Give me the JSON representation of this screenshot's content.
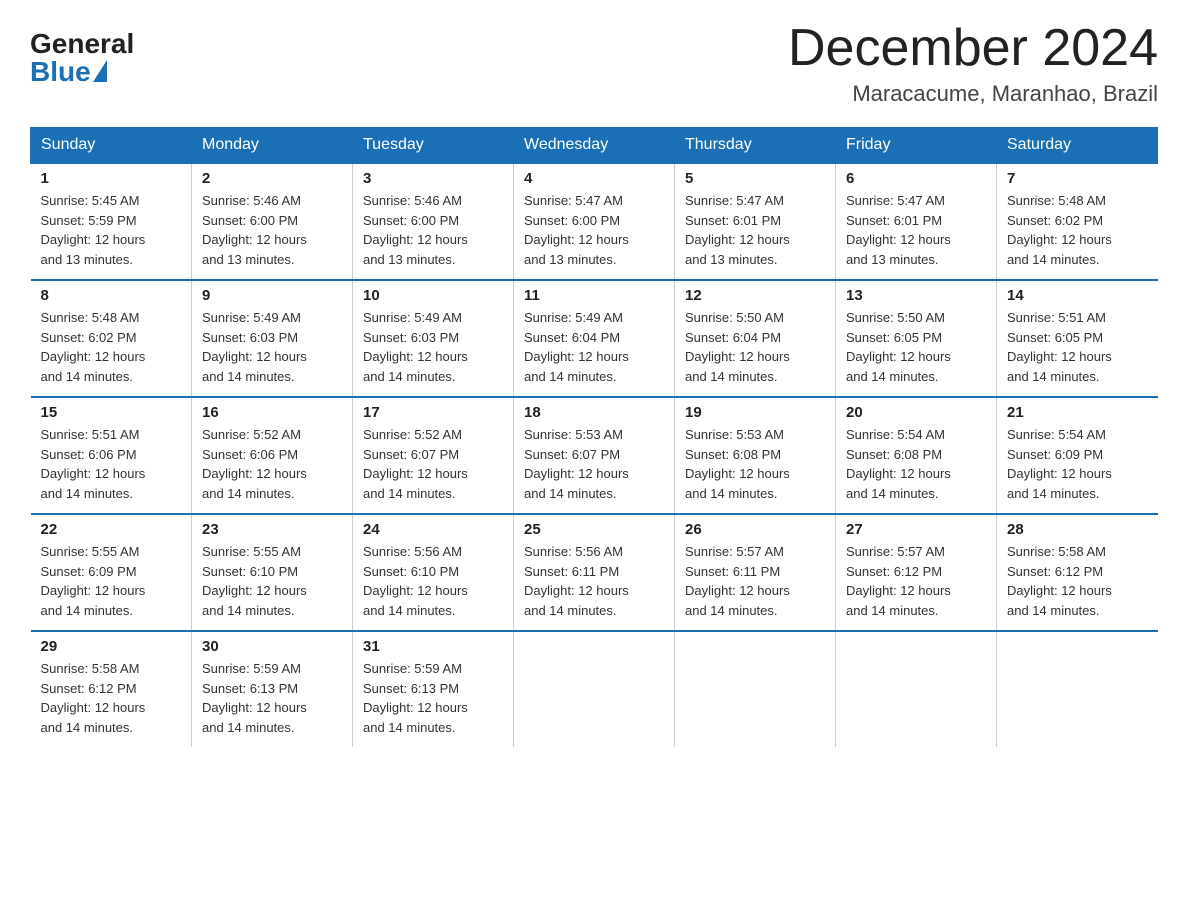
{
  "logo": {
    "general": "General",
    "blue": "Blue"
  },
  "title": "December 2024",
  "location": "Maracacume, Maranhao, Brazil",
  "days_of_week": [
    "Sunday",
    "Monday",
    "Tuesday",
    "Wednesday",
    "Thursday",
    "Friday",
    "Saturday"
  ],
  "weeks": [
    [
      {
        "day": "1",
        "sunrise": "5:45 AM",
        "sunset": "5:59 PM",
        "daylight": "12 hours and 13 minutes."
      },
      {
        "day": "2",
        "sunrise": "5:46 AM",
        "sunset": "6:00 PM",
        "daylight": "12 hours and 13 minutes."
      },
      {
        "day": "3",
        "sunrise": "5:46 AM",
        "sunset": "6:00 PM",
        "daylight": "12 hours and 13 minutes."
      },
      {
        "day": "4",
        "sunrise": "5:47 AM",
        "sunset": "6:00 PM",
        "daylight": "12 hours and 13 minutes."
      },
      {
        "day": "5",
        "sunrise": "5:47 AM",
        "sunset": "6:01 PM",
        "daylight": "12 hours and 13 minutes."
      },
      {
        "day": "6",
        "sunrise": "5:47 AM",
        "sunset": "6:01 PM",
        "daylight": "12 hours and 13 minutes."
      },
      {
        "day": "7",
        "sunrise": "5:48 AM",
        "sunset": "6:02 PM",
        "daylight": "12 hours and 14 minutes."
      }
    ],
    [
      {
        "day": "8",
        "sunrise": "5:48 AM",
        "sunset": "6:02 PM",
        "daylight": "12 hours and 14 minutes."
      },
      {
        "day": "9",
        "sunrise": "5:49 AM",
        "sunset": "6:03 PM",
        "daylight": "12 hours and 14 minutes."
      },
      {
        "day": "10",
        "sunrise": "5:49 AM",
        "sunset": "6:03 PM",
        "daylight": "12 hours and 14 minutes."
      },
      {
        "day": "11",
        "sunrise": "5:49 AM",
        "sunset": "6:04 PM",
        "daylight": "12 hours and 14 minutes."
      },
      {
        "day": "12",
        "sunrise": "5:50 AM",
        "sunset": "6:04 PM",
        "daylight": "12 hours and 14 minutes."
      },
      {
        "day": "13",
        "sunrise": "5:50 AM",
        "sunset": "6:05 PM",
        "daylight": "12 hours and 14 minutes."
      },
      {
        "day": "14",
        "sunrise": "5:51 AM",
        "sunset": "6:05 PM",
        "daylight": "12 hours and 14 minutes."
      }
    ],
    [
      {
        "day": "15",
        "sunrise": "5:51 AM",
        "sunset": "6:06 PM",
        "daylight": "12 hours and 14 minutes."
      },
      {
        "day": "16",
        "sunrise": "5:52 AM",
        "sunset": "6:06 PM",
        "daylight": "12 hours and 14 minutes."
      },
      {
        "day": "17",
        "sunrise": "5:52 AM",
        "sunset": "6:07 PM",
        "daylight": "12 hours and 14 minutes."
      },
      {
        "day": "18",
        "sunrise": "5:53 AM",
        "sunset": "6:07 PM",
        "daylight": "12 hours and 14 minutes."
      },
      {
        "day": "19",
        "sunrise": "5:53 AM",
        "sunset": "6:08 PM",
        "daylight": "12 hours and 14 minutes."
      },
      {
        "day": "20",
        "sunrise": "5:54 AM",
        "sunset": "6:08 PM",
        "daylight": "12 hours and 14 minutes."
      },
      {
        "day": "21",
        "sunrise": "5:54 AM",
        "sunset": "6:09 PM",
        "daylight": "12 hours and 14 minutes."
      }
    ],
    [
      {
        "day": "22",
        "sunrise": "5:55 AM",
        "sunset": "6:09 PM",
        "daylight": "12 hours and 14 minutes."
      },
      {
        "day": "23",
        "sunrise": "5:55 AM",
        "sunset": "6:10 PM",
        "daylight": "12 hours and 14 minutes."
      },
      {
        "day": "24",
        "sunrise": "5:56 AM",
        "sunset": "6:10 PM",
        "daylight": "12 hours and 14 minutes."
      },
      {
        "day": "25",
        "sunrise": "5:56 AM",
        "sunset": "6:11 PM",
        "daylight": "12 hours and 14 minutes."
      },
      {
        "day": "26",
        "sunrise": "5:57 AM",
        "sunset": "6:11 PM",
        "daylight": "12 hours and 14 minutes."
      },
      {
        "day": "27",
        "sunrise": "5:57 AM",
        "sunset": "6:12 PM",
        "daylight": "12 hours and 14 minutes."
      },
      {
        "day": "28",
        "sunrise": "5:58 AM",
        "sunset": "6:12 PM",
        "daylight": "12 hours and 14 minutes."
      }
    ],
    [
      {
        "day": "29",
        "sunrise": "5:58 AM",
        "sunset": "6:12 PM",
        "daylight": "12 hours and 14 minutes."
      },
      {
        "day": "30",
        "sunrise": "5:59 AM",
        "sunset": "6:13 PM",
        "daylight": "12 hours and 14 minutes."
      },
      {
        "day": "31",
        "sunrise": "5:59 AM",
        "sunset": "6:13 PM",
        "daylight": "12 hours and 14 minutes."
      },
      null,
      null,
      null,
      null
    ]
  ],
  "labels": {
    "sunrise": "Sunrise:",
    "sunset": "Sunset:",
    "daylight": "Daylight:"
  }
}
